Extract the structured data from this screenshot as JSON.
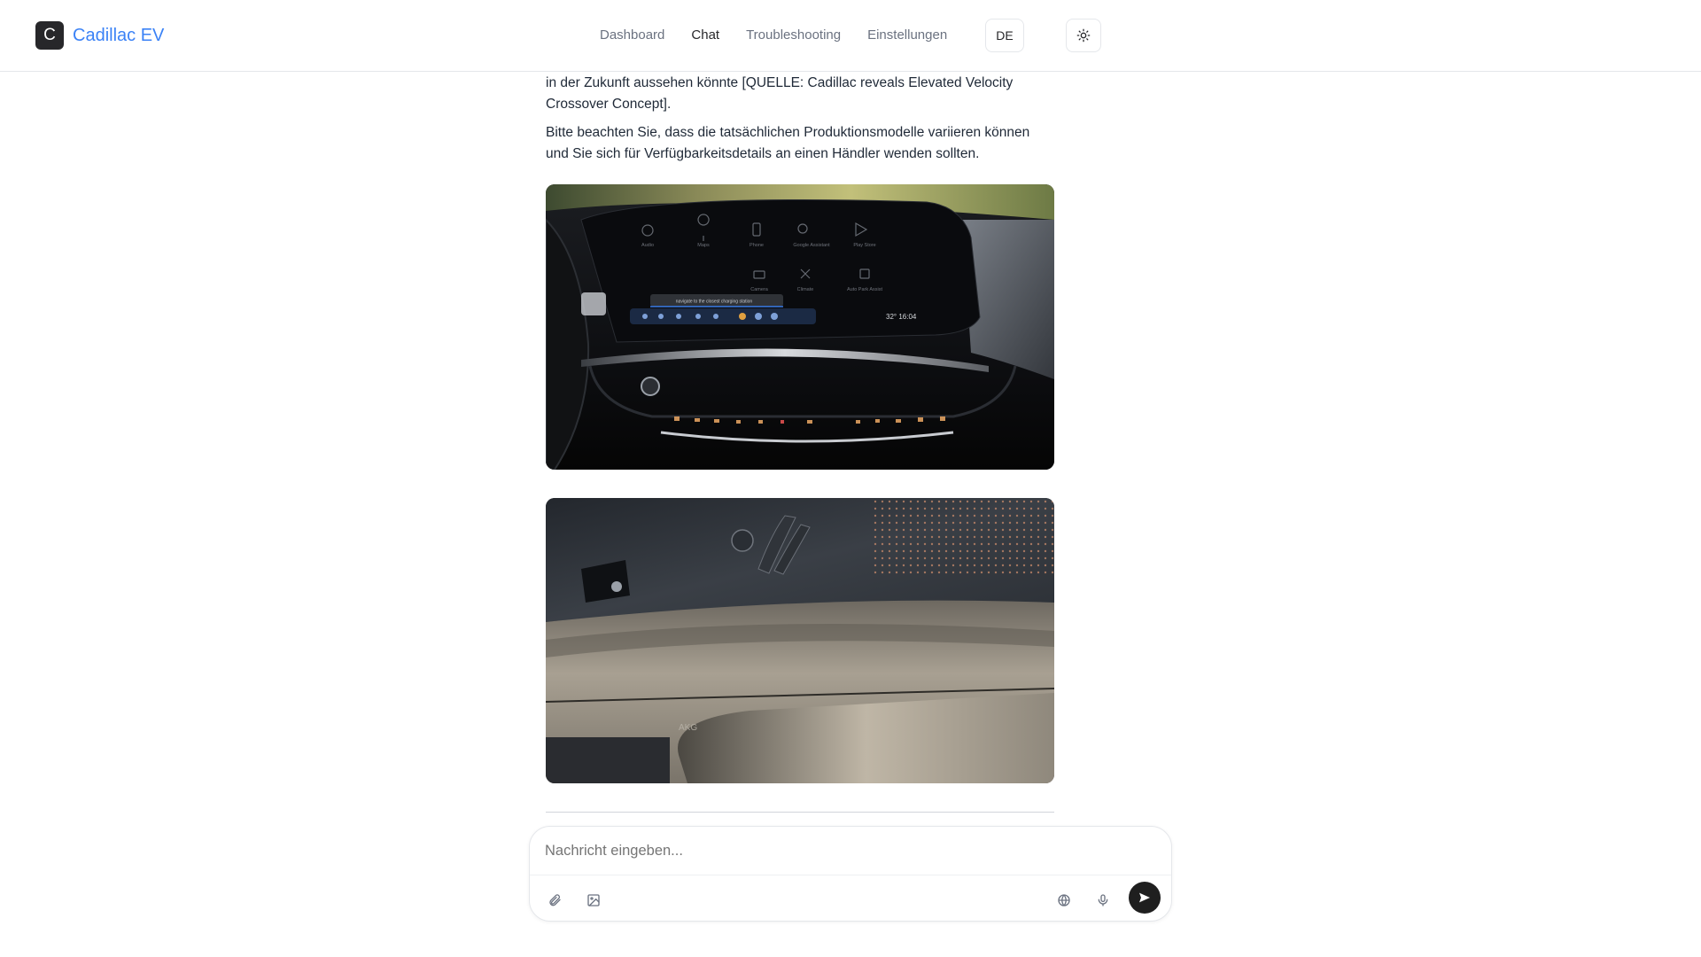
{
  "app": {
    "logo_letter": "C",
    "title": "Cadillac EV"
  },
  "nav": {
    "items": [
      {
        "label": "Dashboard"
      },
      {
        "label": "Chat"
      },
      {
        "label": "Troubleshooting"
      },
      {
        "label": "Einstellungen"
      }
    ],
    "active": "Chat"
  },
  "header": {
    "language": "DE",
    "theme_icon": "sun-icon"
  },
  "messages": {
    "p1": "Fortführung dessen, wie die erfolgreiche Formel der Cadillac V-Series Performance in der Zukunft aussehen könnte [QUELLE: Cadillac reveals Elevated Velocity Crossover Concept].",
    "p2": "Bitte beachten Sie, dass die tatsächlichen Produktionsmodelle variieren können und Sie sich für Verfügbarkeitsdetails an einen Händler wenden sollten.",
    "images": [
      {
        "name": "dashboard-infotainment-photo",
        "screen_time": "32° 16:04",
        "toast": "navigate to the closest charging station",
        "apps": [
          "Audio",
          "Maps",
          "Phone",
          "Google Assistant",
          "Play Store",
          "Camera",
          "Climate",
          "Auto Park Assist"
        ]
      },
      {
        "name": "door-panel-interior-photo",
        "brand_mark": "AKG"
      }
    ]
  },
  "composer": {
    "placeholder": "Nachricht eingeben...",
    "icons": [
      "paperclip-icon",
      "image-icon",
      "globe-icon",
      "microphone-icon",
      "send-icon"
    ]
  },
  "colors": {
    "accent": "#3b82f6",
    "dark": "#27272a"
  }
}
